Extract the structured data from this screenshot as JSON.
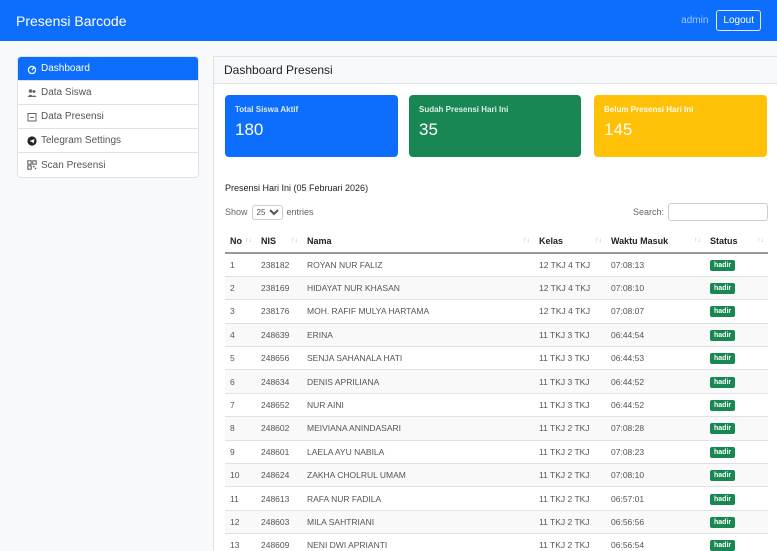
{
  "navbar": {
    "brand": "Presensi Barcode",
    "user": "admin",
    "logout_label": "Logout"
  },
  "sidebar": {
    "items": [
      {
        "label": "Dashboard",
        "icon": "dashboard-icon",
        "active": true
      },
      {
        "label": "Data Siswa",
        "icon": "users-icon",
        "active": false
      },
      {
        "label": "Data Presensi",
        "icon": "calendar-icon",
        "active": false
      },
      {
        "label": "Telegram Settings",
        "icon": "telegram-icon",
        "active": false
      },
      {
        "label": "Scan Presensi",
        "icon": "qrcode-icon",
        "active": false
      }
    ]
  },
  "main": {
    "title": "Dashboard Presensi",
    "cards": [
      {
        "label": "Total Siswa Aktif",
        "value": "180",
        "color": "#0d6efd"
      },
      {
        "label": "Sudah Presensi Hari Ini",
        "value": "35",
        "color": "#198754"
      },
      {
        "label": "Belum Presensi Hari Ini",
        "value": "145",
        "color": "#ffc107"
      }
    ],
    "subheading": "Presensi Hari Ini (05 Februari 2026)",
    "show_label": "Show",
    "entries_value": "25",
    "entries_label": "entries",
    "search_label": "Search:",
    "search_value": ""
  },
  "table": {
    "headers": [
      "No",
      "NIS",
      "Nama",
      "Kelas",
      "Waktu Masuk",
      "Status"
    ],
    "rows": [
      [
        "1",
        "238182",
        "Royan Nur Faliz",
        "12 TKJ 4 TKJ",
        "07:08:13",
        "hadir"
      ],
      [
        "2",
        "238169",
        "Hidayat Nur Khasan",
        "12 TKJ 4 TKJ",
        "07:08:10",
        "hadir"
      ],
      [
        "3",
        "238176",
        "Moh. Rafif Mulya Hartama",
        "12 TKJ 4 TKJ",
        "07:08:07",
        "hadir"
      ],
      [
        "4",
        "248639",
        "Erina",
        "11 TKJ 3 TKJ",
        "06:44:54",
        "hadir"
      ],
      [
        "5",
        "248656",
        "Senja Sahanala Hati",
        "11 TKJ 3 TKJ",
        "06:44:53",
        "hadir"
      ],
      [
        "6",
        "248634",
        "Denis Apriliana",
        "11 TKJ 3 TKJ",
        "06:44:52",
        "hadir"
      ],
      [
        "7",
        "248652",
        "Nur Aini",
        "11 TKJ 3 TKJ",
        "06:44:52",
        "hadir"
      ],
      [
        "8",
        "248602",
        "Meiviana Anindasari",
        "11 TKJ 2 TKJ",
        "07:08:28",
        "hadir"
      ],
      [
        "9",
        "248601",
        "Laela Ayu Nabila",
        "11 TKJ 2 TKJ",
        "07:08:23",
        "hadir"
      ],
      [
        "10",
        "248624",
        "Zakha Cholrul Umam",
        "11 TKJ 2 TKJ",
        "07:08:10",
        "hadir"
      ],
      [
        "11",
        "248613",
        "Rafa Nur Fadila",
        "11 TKJ 2 TKJ",
        "06:57:01",
        "hadir"
      ],
      [
        "12",
        "248603",
        "Mila Sahtriani",
        "11 TKJ 2 TKJ",
        "06:56:56",
        "hadir"
      ],
      [
        "13",
        "248609",
        "Neni Dwi Aprianti",
        "11 TKJ 2 TKJ",
        "06:56:54",
        "hadir"
      ]
    ]
  }
}
